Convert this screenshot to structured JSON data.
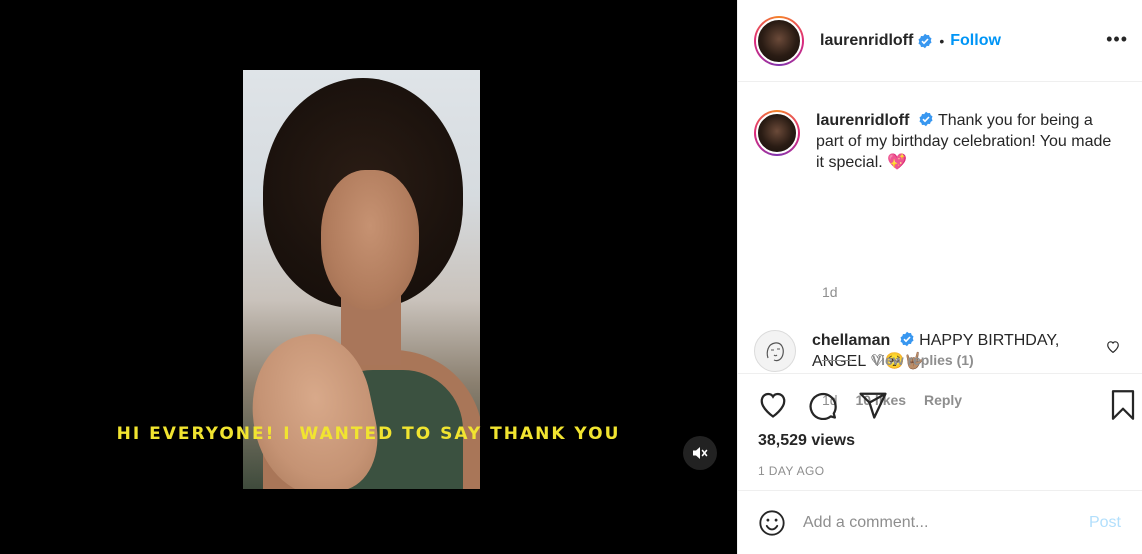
{
  "media": {
    "caption": "HI EVERYONE!  I WANTED TO SAY THANK YOU",
    "mute_icon": "volume-muted-icon"
  },
  "header": {
    "username": "laurenridloff",
    "dot": "•",
    "follow_label": "Follow",
    "more_label": "•••"
  },
  "post_caption": {
    "username": "laurenridloff",
    "text": "Thank you for being a part of my birthday celebration! You made it special. 💖",
    "time": "1d"
  },
  "comments": [
    {
      "username": "chellaman",
      "text": "HAPPY BIRTHDAY, ANGEL ♡🥺🤟🏽",
      "time": "1d",
      "likes": "10 likes",
      "reply_label": "Reply",
      "view_replies": "View replies (1)"
    }
  ],
  "actions": {
    "views": "38,529 views",
    "time_ago": "1 DAY AGO"
  },
  "add_comment": {
    "placeholder": "Add a comment...",
    "post_label": "Post"
  },
  "colors": {
    "accent": "#0095f6",
    "caption_yellow": "#f1e430",
    "post_disabled": "#b2dffc",
    "muted_text": "#8e8e8e"
  }
}
